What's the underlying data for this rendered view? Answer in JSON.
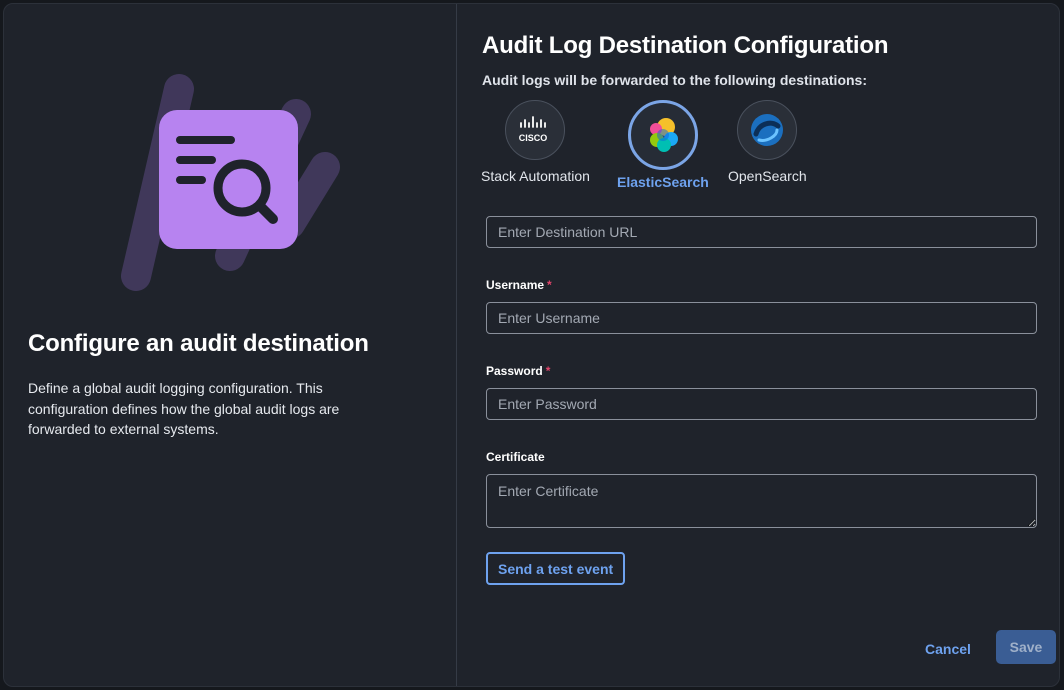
{
  "left": {
    "title": "Configure an audit destination",
    "description": "Define a global audit logging configuration. This configuration defines how the global audit logs are forwarded to external systems."
  },
  "right": {
    "title": "Audit Log Destination Configuration",
    "subtitle": "Audit logs will be forwarded to the following destinations:",
    "destinations": [
      {
        "label": "Stack Automation",
        "logo_text": "CISCO",
        "icon": "cisco-logo",
        "selected": false
      },
      {
        "label": "ElasticSearch",
        "icon": "elasticsearch-logo",
        "selected": true
      },
      {
        "label": "OpenSearch",
        "icon": "opensearch-logo",
        "selected": false
      }
    ],
    "fields": {
      "url": {
        "placeholder": "Enter Destination URL",
        "value": ""
      },
      "username": {
        "label": "Username",
        "required_mark": "*",
        "placeholder": "Enter Username",
        "value": ""
      },
      "password": {
        "label": "Password",
        "required_mark": "*",
        "placeholder": "Enter Password",
        "value": ""
      },
      "certificate": {
        "label": "Certificate",
        "placeholder": "Enter Certificate",
        "value": ""
      }
    },
    "test_button": "Send a test event"
  },
  "footer": {
    "cancel": "Cancel",
    "save": "Save"
  },
  "colors": {
    "accent": "#6ea2ef",
    "required": "#e0456b",
    "illustration_purple": "#b783f0",
    "save_disabled": "#3a5d94"
  }
}
